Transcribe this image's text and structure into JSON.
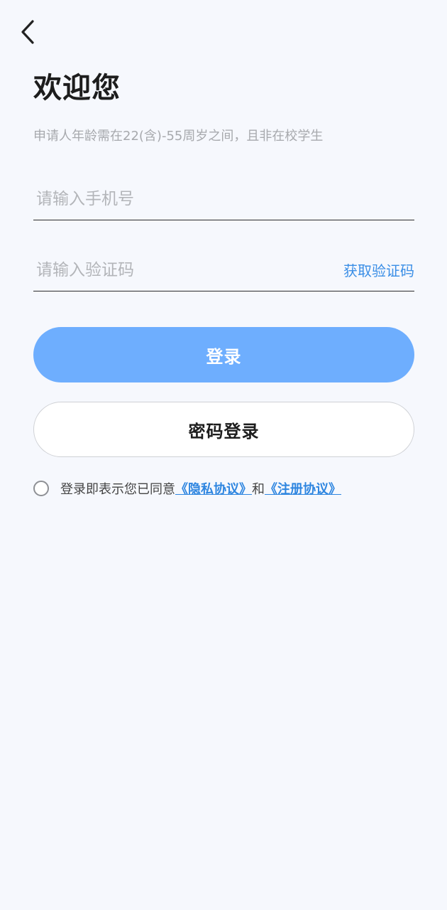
{
  "header": {
    "back_icon": "chevron-left-icon"
  },
  "welcome": {
    "title": "欢迎您",
    "subtitle": "申请人年龄需在22(含)-55周岁之间，且非在校学生"
  },
  "form": {
    "phone_placeholder": "请输入手机号",
    "phone_value": "",
    "code_placeholder": "请输入验证码",
    "code_value": "",
    "get_code_label": "获取验证码"
  },
  "actions": {
    "login_label": "登录",
    "password_login_label": "密码登录"
  },
  "agreement": {
    "checked": false,
    "prefix": "登录即表示您已同意",
    "privacy_link": "《隐私协议》",
    "connector": "和",
    "register_link": "《注册协议》"
  },
  "colors": {
    "background": "#f6f8fd",
    "primary": "#6eaefe",
    "link": "#2f86e0"
  }
}
